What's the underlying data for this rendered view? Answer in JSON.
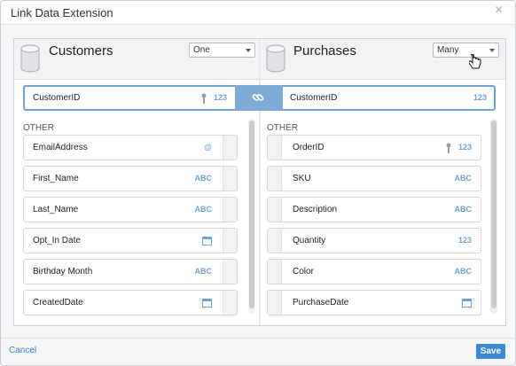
{
  "dialog": {
    "title": "Link Data Extension",
    "close_label": "×"
  },
  "left": {
    "title": "Customers",
    "cardinality": "One",
    "key_field": "CustomerID",
    "key_type": "123",
    "section": "OTHER",
    "fields": [
      {
        "label": "EmailAddress",
        "type_glyph": "@",
        "type": "email-icon"
      },
      {
        "label": "First_Name",
        "type_glyph": "ABC",
        "type": "text-icon"
      },
      {
        "label": "Last_Name",
        "type_glyph": "ABC",
        "type": "text-icon"
      },
      {
        "label": "Opt_In Date",
        "type_glyph": "",
        "type": "calendar-icon"
      },
      {
        "label": "Birthday Month",
        "type_glyph": "ABC",
        "type": "text-icon"
      },
      {
        "label": "CreatedDate",
        "type_glyph": "",
        "type": "calendar-icon"
      }
    ]
  },
  "right": {
    "title": "Purchases",
    "cardinality": "Many",
    "key_field": "CustomerID",
    "key_type": "123",
    "section": "OTHER",
    "fields": [
      {
        "label": "OrderID",
        "type_glyph": "123",
        "type": "number-icon",
        "is_key": true
      },
      {
        "label": "SKU",
        "type_glyph": "ABC",
        "type": "text-icon"
      },
      {
        "label": "Description",
        "type_glyph": "ABC",
        "type": "text-icon"
      },
      {
        "label": "Quantity",
        "type_glyph": "123",
        "type": "number-icon"
      },
      {
        "label": "Color",
        "type_glyph": "ABC",
        "type": "text-icon"
      },
      {
        "label": "PurchaseDate",
        "type_glyph": "",
        "type": "calendar-icon"
      }
    ]
  },
  "footer": {
    "cancel_label": "Cancel",
    "save_label": "Save"
  },
  "colors": {
    "accent": "#3b8ad6",
    "link_block": "#7faad6",
    "type_tag": "#6fa3d6"
  }
}
